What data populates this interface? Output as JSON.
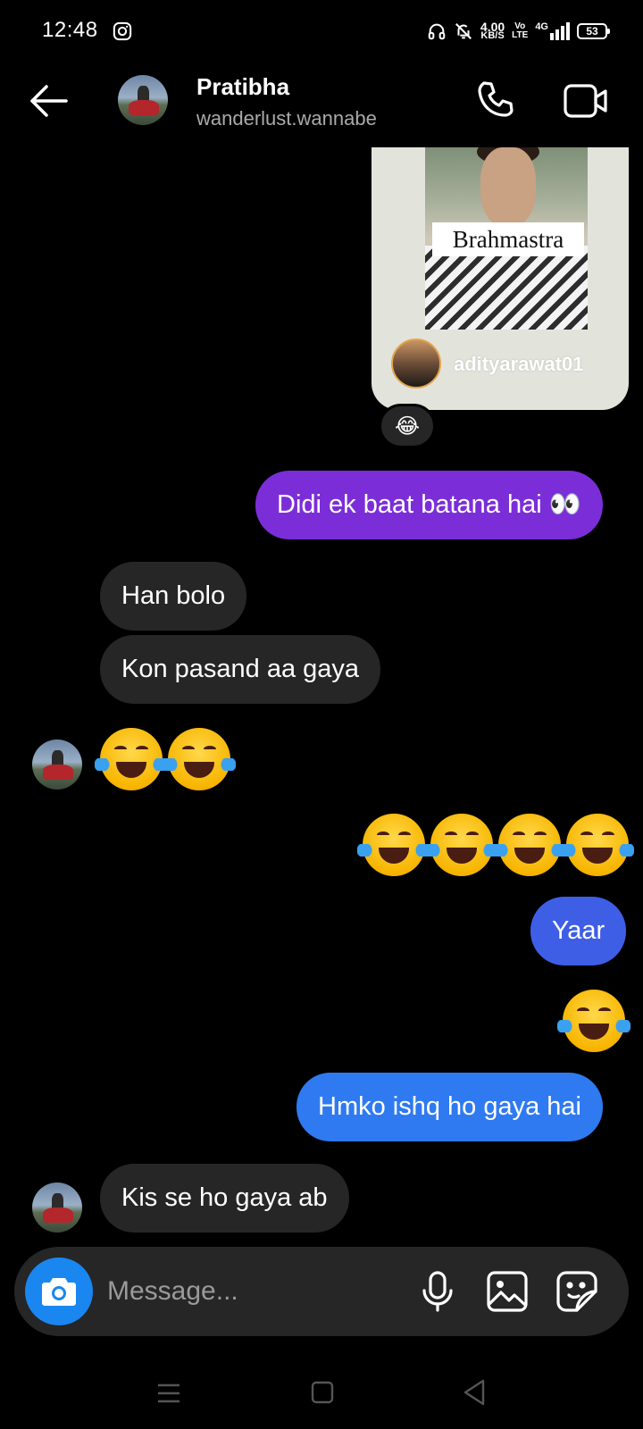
{
  "status_bar": {
    "time": "12:48",
    "net_speed_value": "4.00",
    "net_speed_unit": "KB/S",
    "volte_top": "Vo",
    "volte_bottom": "LTE",
    "network": "4G",
    "battery": "53"
  },
  "header": {
    "name": "Pratibha",
    "username": "wanderlust.wannabe"
  },
  "shared_post": {
    "title": "Brahmastra",
    "author": "adityarawat01",
    "reaction": "😂"
  },
  "messages": [
    {
      "id": "m1",
      "side": "sent",
      "text": "Didi ek baat batana hai 👀"
    },
    {
      "id": "m2",
      "side": "received",
      "text": "Han bolo"
    },
    {
      "id": "m3",
      "side": "received",
      "text": "Kon pasand aa gaya"
    },
    {
      "id": "m4",
      "side": "received",
      "emoji": "😂😂",
      "count": 2
    },
    {
      "id": "m5",
      "side": "sent",
      "emoji": "😂😂😂😂",
      "count": 4
    },
    {
      "id": "m6",
      "side": "sent",
      "text": "Yaar"
    },
    {
      "id": "m7",
      "side": "sent",
      "emoji": "😂",
      "count": 1
    },
    {
      "id": "m8",
      "side": "sent",
      "text": "Hmko ishq ho gaya hai"
    },
    {
      "id": "m9",
      "side": "received",
      "text": "Kis se ho gaya ab"
    }
  ],
  "composer": {
    "placeholder": "Message..."
  },
  "colors": {
    "background": "#000000",
    "received_bubble": "#262626",
    "sent_purple": "#7b2ed8",
    "sent_blue_1": "#3f5ee6",
    "sent_blue_2": "#2f7af0",
    "camera_button": "#1a86f0"
  },
  "icons": {
    "status": [
      "instagram-icon",
      "headphones-icon",
      "bell-off-icon",
      "signal-icon",
      "battery-icon"
    ],
    "header": [
      "back-arrow-icon",
      "phone-call-icon",
      "video-call-icon"
    ],
    "composer": [
      "camera-icon",
      "microphone-icon",
      "gallery-icon",
      "sticker-icon"
    ],
    "nav": [
      "menu-icon",
      "home-icon",
      "back-icon"
    ]
  }
}
